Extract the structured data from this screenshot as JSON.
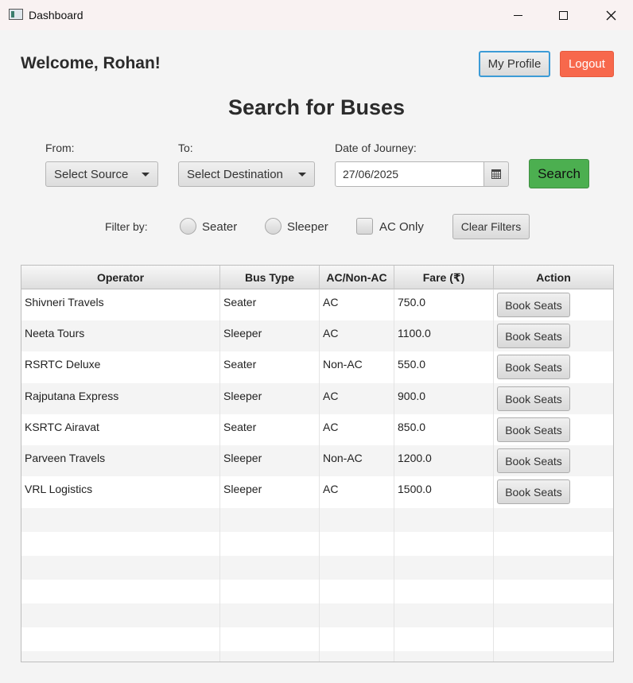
{
  "window": {
    "title": "Dashboard",
    "icon": "app-window-icon"
  },
  "header": {
    "welcome": "Welcome, Rohan!",
    "profile_label": "My Profile",
    "logout_label": "Logout"
  },
  "search": {
    "title": "Search for Buses",
    "from_label": "From:",
    "from_value": "Select Source",
    "to_label": "To:",
    "to_value": "Select Destination",
    "date_label": "Date of Journey:",
    "date_value": "27/06/2025",
    "search_label": "Search"
  },
  "filters": {
    "label": "Filter by:",
    "seater": "Seater",
    "sleeper": "Sleeper",
    "ac_only": "AC Only",
    "clear": "Clear Filters"
  },
  "table": {
    "columns": [
      "Operator",
      "Bus Type",
      "AC/Non-AC",
      "Fare (₹)",
      "Action"
    ],
    "rows": [
      [
        "Shivneri Travels",
        "Seater",
        "AC",
        "750.0",
        "Book Seats"
      ],
      [
        "Neeta Tours",
        "Sleeper",
        "AC",
        "1100.0",
        "Book Seats"
      ],
      [
        "RSRTC Deluxe",
        "Seater",
        "Non-AC",
        "550.0",
        "Book Seats"
      ],
      [
        "Rajputana Express",
        "Sleeper",
        "AC",
        "900.0",
        "Book Seats"
      ],
      [
        "KSRTC Airavat",
        "Seater",
        "AC",
        "850.0",
        "Book Seats"
      ],
      [
        "Parveen Travels",
        "Sleeper",
        "Non-AC",
        "1200.0",
        "Book Seats"
      ],
      [
        "VRL Logistics",
        "Sleeper",
        "AC",
        "1500.0",
        "Book Seats"
      ]
    ]
  },
  "colors": {
    "search_button": "#4caf50",
    "logout_button": "#f7684c",
    "focus_ring": "#3c9bd6"
  }
}
